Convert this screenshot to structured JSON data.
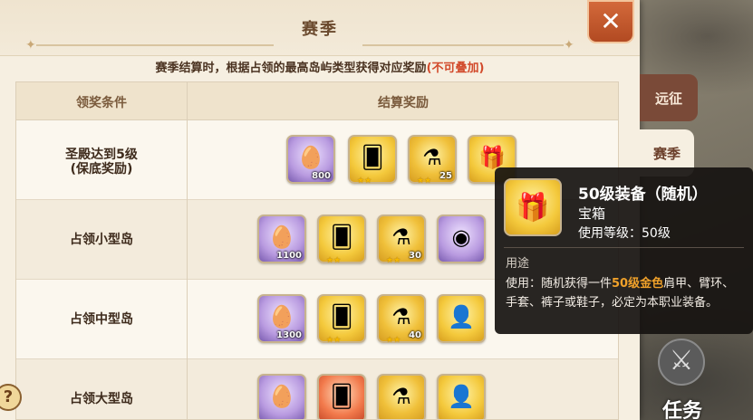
{
  "header": {
    "title": "赛季",
    "description": "赛季结算时，根据占领的最高岛屿类型获得对应奖励",
    "description_highlight": "(不可叠加)"
  },
  "table": {
    "columns": [
      "领奖条件",
      "结算奖励"
    ],
    "rows": [
      {
        "condition_line1": "圣殿达到5级",
        "condition_line2": "(保底奖励)",
        "rewards": [
          {
            "icon": "crystal-egg-icon",
            "qty": "800",
            "stars": ""
          },
          {
            "icon": "card-icon",
            "qty": "",
            "stars": "★★"
          },
          {
            "icon": "potion-icon",
            "qty": "25",
            "stars": "★★"
          },
          {
            "icon": "treasure-chest-icon",
            "qty": "",
            "stars": ""
          }
        ]
      },
      {
        "condition_line1": "占领小型岛",
        "condition_line2": "",
        "rewards": [
          {
            "icon": "crystal-egg-icon",
            "qty": "1100",
            "stars": ""
          },
          {
            "icon": "card-icon",
            "qty": "",
            "stars": "★★"
          },
          {
            "icon": "potion-icon",
            "qty": "30",
            "stars": "★★"
          },
          {
            "icon": "spirit-orb-icon",
            "qty": "",
            "stars": ""
          }
        ]
      },
      {
        "condition_line1": "占领中型岛",
        "condition_line2": "",
        "rewards": [
          {
            "icon": "crystal-egg-icon",
            "qty": "1300",
            "stars": ""
          },
          {
            "icon": "card-icon",
            "qty": "",
            "stars": "★★"
          },
          {
            "icon": "potion-icon",
            "qty": "40",
            "stars": "★★"
          },
          {
            "icon": "shadow-creature-icon",
            "qty": "",
            "stars": ""
          }
        ]
      },
      {
        "condition_line1": "占领大型岛",
        "condition_line2": "",
        "rewards": [
          {
            "icon": "crystal-egg-icon",
            "qty": "",
            "stars": ""
          },
          {
            "icon": "card-icon",
            "qty": "",
            "stars": ""
          },
          {
            "icon": "potion-icon",
            "qty": "",
            "stars": ""
          },
          {
            "icon": "shadow-creature-icon",
            "qty": "",
            "stars": ""
          }
        ]
      }
    ]
  },
  "side_tabs": [
    {
      "label": "远征"
    },
    {
      "label": "赛季"
    }
  ],
  "tooltip": {
    "name": "50级装备（随机）",
    "type": "宝箱",
    "level": "使用等级：50级",
    "use_title": "用途",
    "desc_prefix": "使用：随机获得一件",
    "desc_highlight": "50级金色",
    "desc_suffix": "肩甲、臂环、手套、裤子或鞋子，必定为本职业装备。"
  },
  "task_button": {
    "label": "任务",
    "icon": "crossed-swords-icon"
  },
  "help_button": {
    "label": "?"
  },
  "close_button": {
    "icon": "close-icon"
  },
  "colors": {
    "accent": "#d24a2b",
    "panel": "#f6efe1",
    "gold": "#f0a12a"
  }
}
